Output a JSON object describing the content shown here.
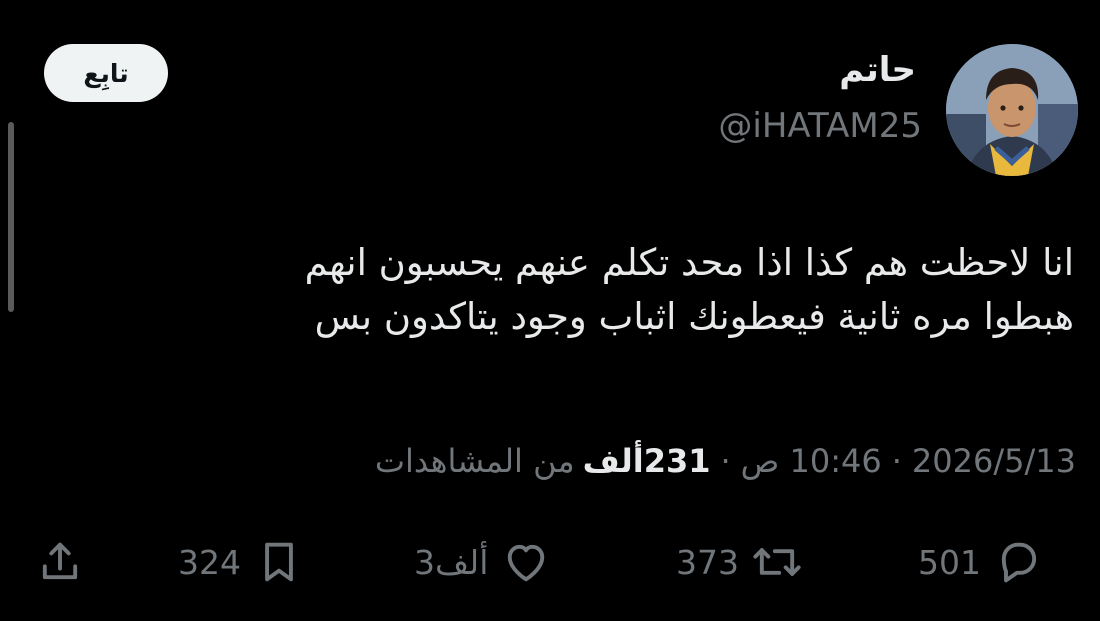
{
  "tweet": {
    "display_name": "حاتم",
    "handle": "@iHATAM25",
    "follow_label": "تابِع",
    "text_lines": [
      "انا لاحظت هم كذا اذا محد تكلم عنهم يحسبون انهم",
      "هبطوا مره ثانية فيعطونك اثباب وجود يتاكدون بس"
    ],
    "date": "2026/5/13",
    "time": "10:46 ص",
    "views_count": "231ألف",
    "views_label": "من المشاهدات"
  },
  "actions": {
    "replies": "501",
    "retweets": "373",
    "likes": "3ألف",
    "bookmarks": "324"
  },
  "icons": [
    "reply-icon",
    "retweet-icon",
    "like-icon",
    "bookmark-icon",
    "share-icon"
  ],
  "colors": {
    "background": "#000000",
    "primary_text": "#e7e9ea",
    "secondary_text": "#71767b",
    "follow_button_bg": "#eff3f4"
  }
}
